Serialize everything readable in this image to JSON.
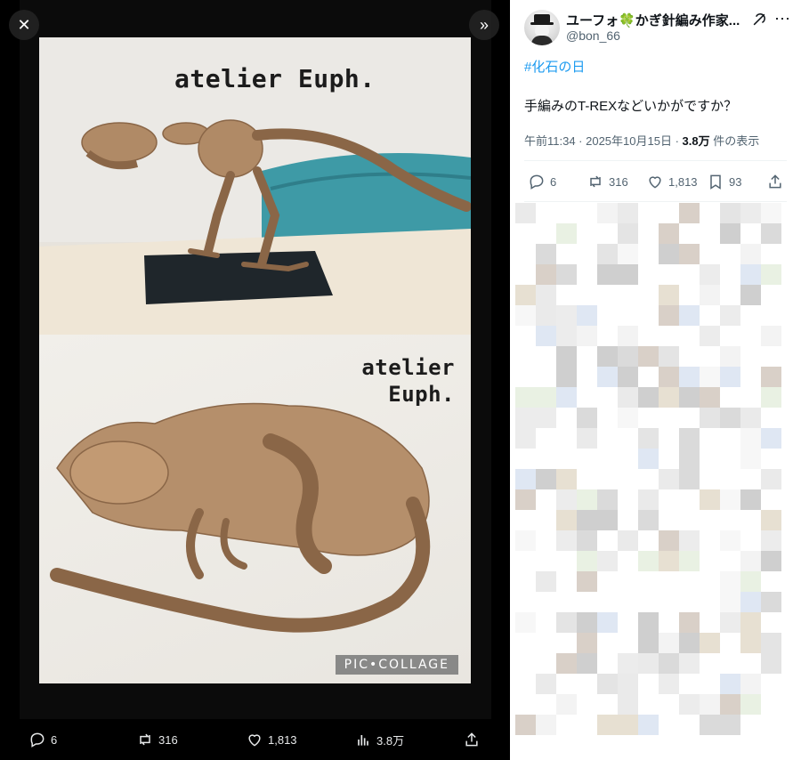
{
  "viewer": {
    "photo_top_watermark": "atelier Euph.",
    "photo_bottom_watermark_line1": "atelier",
    "photo_bottom_watermark_line2": "Euph.",
    "pic_collage_label": "PIC•COLLAGE",
    "bar": {
      "replies": "6",
      "reposts": "316",
      "likes": "1,813",
      "views": "3.8万"
    }
  },
  "tweet": {
    "display_name": "ユーフォ🍀かぎ針編み作家...",
    "handle": "@bon_66",
    "hashtag": "#化石の日",
    "text": "手編みのT-REXなどいかがですか？",
    "time": "午前11:34 · 2025年10月15日 · ",
    "views_count": "3.8万",
    "views_suffix": " 件の表示",
    "actions": {
      "replies": "6",
      "reposts": "316",
      "likes": "1,813",
      "bookmarks": "93"
    }
  },
  "colors": {
    "accent": "#1d9bf0",
    "text_primary": "#0f1419",
    "text_secondary": "#536471"
  },
  "icons": [
    "close-icon",
    "expand-icon",
    "reply-icon",
    "repost-icon",
    "like-icon",
    "views-icon",
    "share-icon",
    "grok-icon",
    "more-icon",
    "bookmark-icon"
  ]
}
